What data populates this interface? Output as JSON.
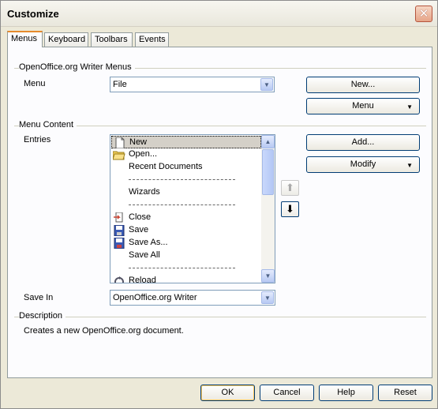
{
  "window": {
    "title": "Customize"
  },
  "tabs": [
    {
      "label": "Menus",
      "active": true
    },
    {
      "label": "Keyboard"
    },
    {
      "label": "Toolbars"
    },
    {
      "label": "Events"
    }
  ],
  "menus_section": {
    "heading": "OpenOffice.org Writer Menus",
    "menu_label": "Menu",
    "menu_value": "File",
    "new_button": "New...",
    "menu_button": "Menu"
  },
  "content_section": {
    "heading": "Menu Content",
    "entries_label": "Entries",
    "entries": [
      {
        "label": "New",
        "icon": "new-document-icon",
        "selected": true
      },
      {
        "label": "Open...",
        "icon": "open-folder-icon"
      },
      {
        "label": "Recent Documents",
        "icon": ""
      },
      {
        "label": "----------------------------------",
        "separator": true
      },
      {
        "label": "Wizards",
        "icon": ""
      },
      {
        "label": "----------------------------------",
        "separator": true
      },
      {
        "label": "Close",
        "icon": "close-document-icon"
      },
      {
        "label": "Save",
        "icon": "save-icon"
      },
      {
        "label": "Save As...",
        "icon": "save-as-icon"
      },
      {
        "label": "Save All",
        "icon": ""
      },
      {
        "label": "----------------------------------",
        "separator": true
      },
      {
        "label": "Reload",
        "icon": "reload-icon"
      }
    ],
    "add_button": "Add...",
    "modify_button": "Modify",
    "save_in_label": "Save In",
    "save_in_value": "OpenOffice.org Writer"
  },
  "description": {
    "heading": "Description",
    "text": "Creates a new OpenOffice.org document."
  },
  "footer": {
    "ok": "OK",
    "cancel": "Cancel",
    "help": "Help",
    "reset": "Reset"
  },
  "colors": {
    "dialog_bg": "#ece9d8",
    "panel_bg": "#fcfcfe",
    "active_tab_accent": "#e68b2c",
    "button_border": "#003c74",
    "close_button": "#e6a488"
  }
}
